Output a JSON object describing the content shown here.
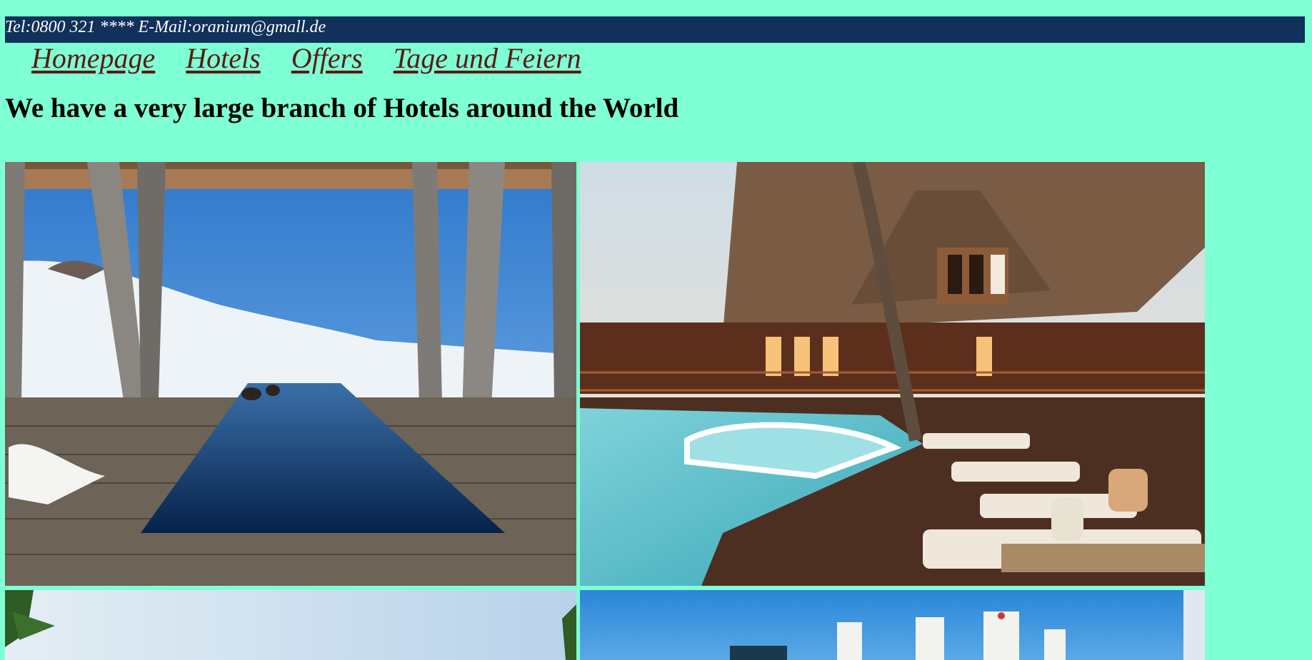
{
  "contact": {
    "text": "Tel:0800 321 **** E-Mail:oranium@gmall.de"
  },
  "nav": {
    "items": [
      {
        "label": "Homepage"
      },
      {
        "label": "Hotels"
      },
      {
        "label": "Offers"
      },
      {
        "label": "Tage und Feiern"
      }
    ]
  },
  "main": {
    "heading": "We have a very large branch of Hotels around the World"
  },
  "colors": {
    "page_bg": "#7fffd4",
    "topbar_bg": "#11305a",
    "link": "#5a1a14"
  }
}
